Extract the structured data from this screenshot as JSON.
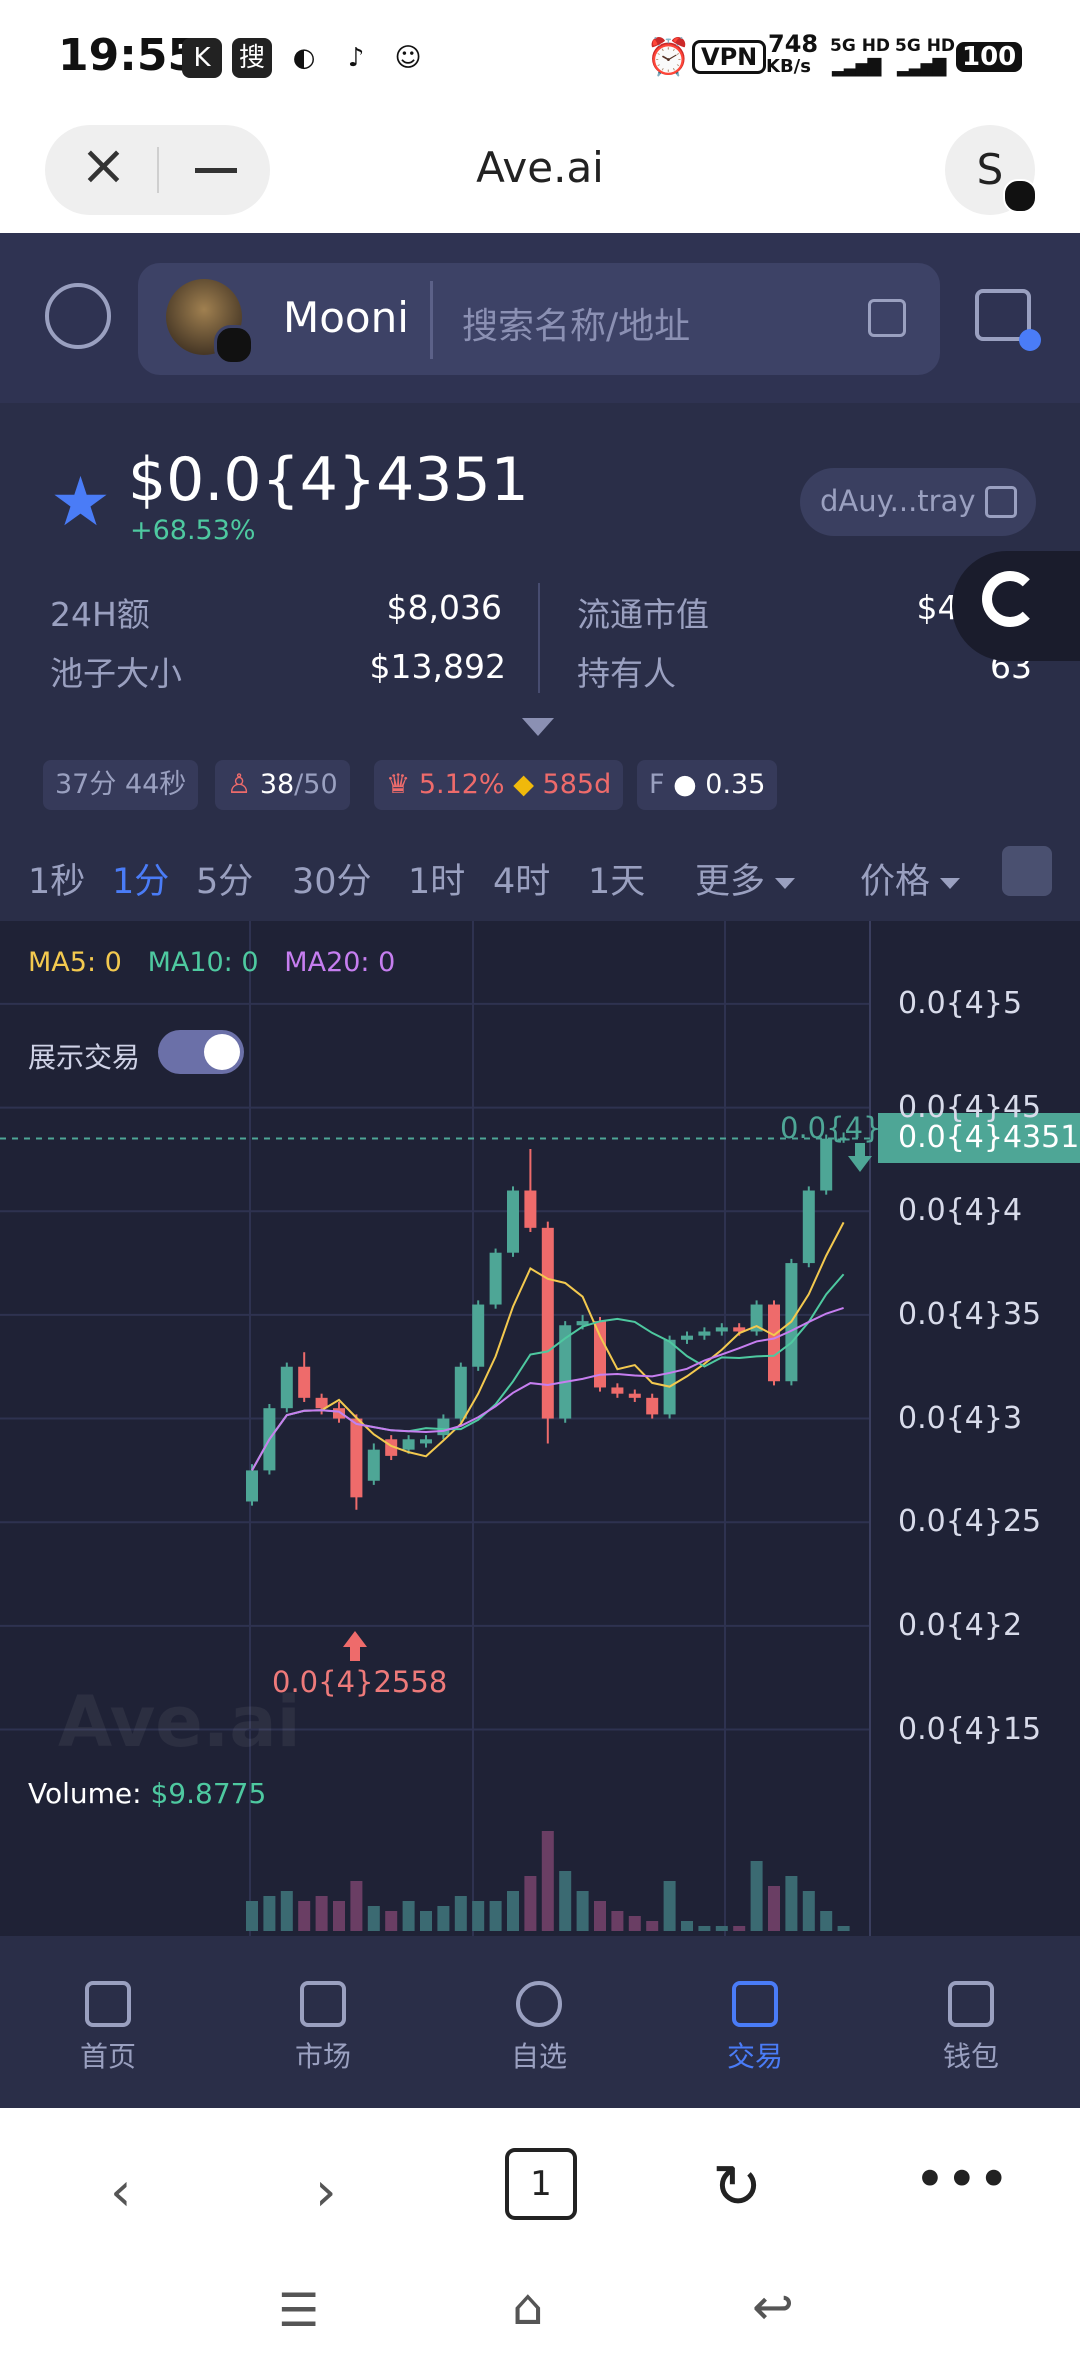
{
  "status_bar": {
    "time": "19:55",
    "app_icons": [
      "K",
      "搜",
      "◐",
      "♪",
      "☺"
    ],
    "speed": "748",
    "speed_unit": "KB/s",
    "net1": "5G HD",
    "net2": "5G HD",
    "battery": "100",
    "vpn": "VPN"
  },
  "browser": {
    "title": "Ave.ai",
    "avatar_letter": "S",
    "tab_count": "1"
  },
  "header": {
    "token_name": "Mooni",
    "search_placeholder": "搜索名称/地址"
  },
  "token": {
    "price": "$0.0{4}4351",
    "change": "+68.53%",
    "address": "dAuy...tray"
  },
  "stats": {
    "vol24h_label": "24H额",
    "vol24h": "$8,036",
    "pool_label": "池子大小",
    "pool": "$13,892",
    "mcap_label": "流通市值",
    "mcap": "$43,51",
    "holders_label": "持有人",
    "holders": "63"
  },
  "tags": {
    "age": "37分 44秒",
    "holders_count": "38",
    "holders_total": "/50",
    "top_pct": "5.12%",
    "bnb_val": "585d",
    "f_label": "F",
    "f_val": "0.35"
  },
  "intervals": {
    "items": [
      "1秒",
      "1分",
      "5分",
      "30分",
      "1时",
      "4时",
      "1天"
    ],
    "active": "1分",
    "more": "更多",
    "price": "价格"
  },
  "chart_legend": {
    "ma5": "MA5: 0",
    "ma10": "MA10: 0",
    "ma20": "MA20: 0",
    "show_trades": "展示交易",
    "volume_label": "Volume:",
    "volume_value": "$9.8775",
    "watermark": "Ave.ai",
    "high_label": "0.0{4}4",
    "low_label": "0.0{4}2558",
    "current_tag": "0.0{4}4351"
  },
  "chart_data": {
    "type": "candlestick",
    "y_ticks": [
      "0.0{4}5",
      "0.0{4}45",
      "0.0{4}4",
      "0.0{4}35",
      "0.0{4}3",
      "0.0{4}25",
      "0.0{4}2",
      "0.0{4}15"
    ],
    "y_tick_values": [
      5.0,
      4.5,
      4.0,
      3.5,
      3.0,
      2.5,
      2.0,
      1.5
    ],
    "ylim": [
      1.3,
      5.4
    ],
    "current": 4.351,
    "candles": [
      [
        2.6,
        2.75,
        2.58,
        2.78
      ],
      [
        2.75,
        3.05,
        2.73,
        3.07
      ],
      [
        3.05,
        3.25,
        3.03,
        3.27
      ],
      [
        3.25,
        3.1,
        3.08,
        3.32
      ],
      [
        3.1,
        3.05,
        3.02,
        3.12
      ],
      [
        3.05,
        3.0,
        2.98,
        3.08
      ],
      [
        3.0,
        2.62,
        2.56,
        3.02
      ],
      [
        2.7,
        2.85,
        2.68,
        2.88
      ],
      [
        2.9,
        2.82,
        2.8,
        2.92
      ],
      [
        2.85,
        2.9,
        2.83,
        2.92
      ],
      [
        2.88,
        2.9,
        2.86,
        2.92
      ],
      [
        2.92,
        3.0,
        2.9,
        3.02
      ],
      [
        3.0,
        3.25,
        2.98,
        3.27
      ],
      [
        3.25,
        3.55,
        3.23,
        3.57
      ],
      [
        3.55,
        3.8,
        3.53,
        3.82
      ],
      [
        3.8,
        4.1,
        3.78,
        4.12
      ],
      [
        4.1,
        3.92,
        3.9,
        4.3
      ],
      [
        3.92,
        3.0,
        2.88,
        3.95
      ],
      [
        3.0,
        3.45,
        2.98,
        3.47
      ],
      [
        3.45,
        3.47,
        3.43,
        3.5
      ],
      [
        3.47,
        3.15,
        3.13,
        3.49
      ],
      [
        3.15,
        3.12,
        3.1,
        3.17
      ],
      [
        3.12,
        3.1,
        3.08,
        3.14
      ],
      [
        3.1,
        3.02,
        3.0,
        3.12
      ],
      [
        3.02,
        3.38,
        3.0,
        3.4
      ],
      [
        3.38,
        3.4,
        3.36,
        3.42
      ],
      [
        3.4,
        3.42,
        3.38,
        3.44
      ],
      [
        3.42,
        3.44,
        3.4,
        3.46
      ],
      [
        3.44,
        3.42,
        3.4,
        3.46
      ],
      [
        3.42,
        3.55,
        3.4,
        3.57
      ],
      [
        3.55,
        3.18,
        3.16,
        3.57
      ],
      [
        3.18,
        3.75,
        3.16,
        3.77
      ],
      [
        3.75,
        4.1,
        3.73,
        4.12
      ],
      [
        4.1,
        4.35,
        4.08,
        4.37
      ],
      [
        4.35,
        4.351,
        4.33,
        4.38
      ]
    ],
    "volumes": [
      0.3,
      0.35,
      0.4,
      0.3,
      0.35,
      0.3,
      0.5,
      0.25,
      0.2,
      0.3,
      0.2,
      0.25,
      0.35,
      0.3,
      0.3,
      0.4,
      0.55,
      1.0,
      0.6,
      0.4,
      0.3,
      0.2,
      0.15,
      0.1,
      0.5,
      0.1,
      0.05,
      0.05,
      0.05,
      0.7,
      0.45,
      0.55,
      0.4,
      0.2,
      0.05
    ]
  },
  "bottom_nav": {
    "home": "首页",
    "market": "市场",
    "watchlist": "自选",
    "trade": "交易",
    "wallet": "钱包"
  },
  "colors": {
    "up": "#4ea696",
    "down": "#ee6b6b",
    "accent": "#4a7cf7",
    "bg": "#2a2e48",
    "chart_bg": "#1f2236"
  }
}
